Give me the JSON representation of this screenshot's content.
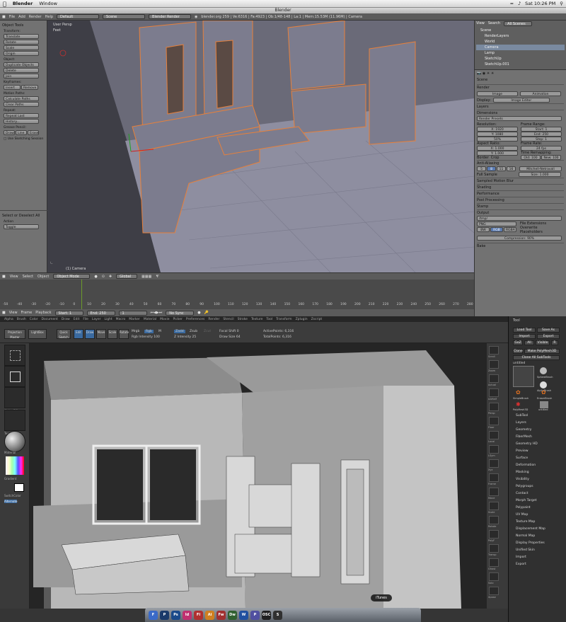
{
  "macbar": {
    "app": "Blender",
    "window": "Window",
    "clock": "Sat 10:26 PM"
  },
  "blender": {
    "title": "Blender",
    "info": {
      "menus": [
        "File",
        "Add",
        "Render",
        "Help"
      ],
      "layout": "Default",
      "scene": "Scene",
      "engine": "Blender Render",
      "stats": "blender.org 259 | Ve:6316 | Fa:4923 | Ob:1/48-148 | La:1 | Mem:15.53M (11.96M) | Camera"
    },
    "tools": {
      "panel_title": "Object Tools",
      "transform_label": "Transform:",
      "transform": [
        "Translate",
        "Rotate",
        "Scale",
        "Origin"
      ],
      "object_label": "Object:",
      "object": [
        "Duplicate Objects",
        "Delete",
        "Join"
      ],
      "keyframes_label": "Keyframes:",
      "keyframes": [
        "Insert",
        "Remove"
      ],
      "motion_label": "Motion Paths:",
      "motion": [
        "Calculate Paths",
        "Clear Paths"
      ],
      "repeat_label": "Repeat:",
      "repeat": [
        "Repeat Last",
        "History..."
      ],
      "grease_label": "Grease Pencil:",
      "grease": [
        "Draw",
        "Line",
        "Erase"
      ],
      "sketch": "Use Sketching Session",
      "op_title": "Select or Deselect All",
      "action_label": "Action",
      "action_value": "Toggle"
    },
    "viewport": {
      "view_name": "User Persp",
      "units": "Feet",
      "object_name": "(1) Camera"
    },
    "viewbar": {
      "menus": [
        "View",
        "Select",
        "Object"
      ],
      "mode": "Object Mode",
      "pivot": "Global"
    },
    "timeline": {
      "ticks": [
        "-50",
        "-40",
        "-30",
        "-20",
        "-10",
        "0",
        "10",
        "20",
        "30",
        "40",
        "50",
        "60",
        "70",
        "80",
        "90",
        "100",
        "110",
        "120",
        "130",
        "140",
        "150",
        "160",
        "170",
        "180",
        "190",
        "200",
        "210",
        "220",
        "230",
        "240",
        "250",
        "260",
        "270",
        "280"
      ]
    },
    "tlbar": {
      "menus": [
        "View",
        "Frame",
        "Playback"
      ],
      "start": "Start: 1",
      "end": "End: 250",
      "frame": "1",
      "sync": "No Sync"
    },
    "outliner": {
      "menus": [
        "View",
        "Search"
      ],
      "filter": "All Scenes",
      "items": [
        "Scene",
        "RenderLayers",
        "World",
        "Camera",
        "Lamp",
        "SketchUp",
        "SketchUp.001"
      ]
    },
    "props": {
      "scene": "Scene",
      "render": "Render",
      "image_btn": "Image",
      "anim_btn": "Animation",
      "display_label": "Display:",
      "display": "Image Editor",
      "layers": "Layers",
      "dimensions": "Dimensions",
      "presets": "Render Presets",
      "res_label": "Resolution:",
      "resx": "X: 1920",
      "resy": "Y: 1080",
      "respct": "50%",
      "fr_label": "Frame Range:",
      "fstart": "Start: 1",
      "fend": "End: 250",
      "fstep": "Step: 1",
      "aspect_label": "Aspect Ratio:",
      "ax": "X: 1.000",
      "ay": "Y: 1.000",
      "frate_label": "Frame Rate:",
      "frate": "24 fps",
      "remap_label": "Time Remapping:",
      "old": "Old: 100",
      "new": "New: 100",
      "border": "Border",
      "crop": "Crop",
      "aa": "Anti-Aliasing",
      "aa_nums": [
        "5",
        "8",
        "11",
        "16"
      ],
      "aa_filter": "Mitchell-Netravali",
      "full": "Full Sample",
      "size": "Size: 1.000",
      "sections": [
        "Sampled Motion Blur",
        "Shading",
        "Performance",
        "Post Processing",
        "Stamp",
        "Output"
      ],
      "out_path": "/tmp/",
      "fmt": "PNG",
      "ext": "File Extensions",
      "overwrite": "Overwrite",
      "placeholders": "Placeholders",
      "bw": "BW",
      "rgb": "RGB",
      "rgba": "RGBA",
      "compression": "Compression: 90%",
      "bake": "Bake"
    }
  },
  "zbrush": {
    "menus": [
      "Alpha",
      "Brush",
      "Color",
      "Document",
      "Draw",
      "Edit",
      "File",
      "Layer",
      "Light",
      "Macro",
      "Marker",
      "Material",
      "Movie",
      "Picker",
      "Preferences",
      "Render",
      "Stencil",
      "Stroke",
      "Texture",
      "Tool",
      "Transform",
      "Zplugin",
      "Zscript"
    ],
    "top": {
      "proj": "Projection Master",
      "light": "LightBox",
      "qs": "Quick Sketch",
      "edit": "Edit",
      "draw": "Draw",
      "move": "Move",
      "scale": "Scale",
      "rotate": "Rotate",
      "mrgb": "Mrgb",
      "rgb": "Rgb",
      "m": "M",
      "rgbint": "Rgb Intensity 100",
      "zadd": "Zadd",
      "zsub": "Zsub",
      "zcut": "Zcut",
      "zint": "Z Intensity 25",
      "focal": "Focal Shift 0",
      "draw_size": "Draw Size 64",
      "ap": "ActivePoints: 6,316",
      "tp": "TotalPoints: 6,316"
    },
    "left": {
      "labels": [
        "SelectRect",
        "Text",
        "Alpha Off",
        "Texture Off",
        "Material",
        "Gradient",
        "SwitchColor",
        "Alternate"
      ]
    },
    "tool": {
      "title": "Tool",
      "btns": [
        "Load Tool",
        "Save As",
        "Import",
        "Export",
        "GoZ",
        "All",
        "Visible",
        "R",
        "Clone",
        "Make PolyMesh3D",
        "Clone All SubTools"
      ],
      "current": "untitled",
      "brushes": [
        "SphereBrush",
        "AlphaBrush",
        "SimpleBrush",
        "EraserBrush",
        "PolyMesh3D",
        "untitled"
      ],
      "items": [
        "SubTool",
        "Layers",
        "Geometry",
        "FiberMesh",
        "Geometry HD",
        "Preview",
        "Surface",
        "Deformation",
        "Masking",
        "Visibility",
        "Polygroups",
        "Contact",
        "Morph Target",
        "Polypaint",
        "UV Map",
        "Texture Map",
        "Displacement Map",
        "Normal Map",
        "Display Properties",
        "Unified Skin",
        "Import",
        "Export"
      ]
    },
    "shelf": [
      "Scroll",
      "Zoom",
      "Actual",
      "AAHalf",
      "Persp",
      "Floor",
      "Local",
      "LSym",
      "Xyz",
      "Frame",
      "Move",
      "Scale",
      "Rotate",
      "PolyF",
      "Transp",
      "Ghost",
      "Solo",
      "Xpose"
    ]
  },
  "dock": {
    "tooltip": "iTunes",
    "icons": [
      "F",
      "P",
      "Ps",
      "Id",
      "Fl",
      "Ai",
      "Fw",
      "Dw",
      "W",
      "P",
      "OSC",
      "S"
    ]
  }
}
